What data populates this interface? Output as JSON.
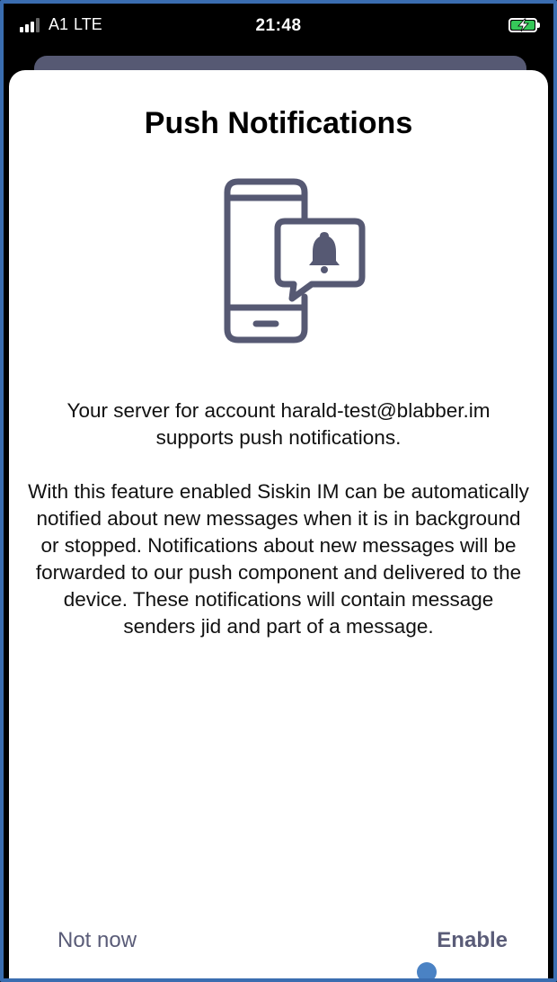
{
  "status_bar": {
    "carrier": "A1",
    "network": "LTE",
    "time": "21:48",
    "signal_bars_active": 3,
    "signal_bars_total": 4,
    "battery_icon": "battery-charging-icon",
    "battery_color": "#36c759"
  },
  "dialog": {
    "title": "Push Notifications",
    "illustration_icon": "phone-notification-bell-icon",
    "paragraph_1": "Your server for account harald-test@blabber.im supports push notifications.",
    "paragraph_2": "With this feature enabled Siskin IM can be automatically notified about new messages when it is in background or stopped. Notifications about new messages will be forwarded to our push component and delivered to the device. These notifications will contain message senders jid and part of a message.",
    "buttons": {
      "not_now": "Not now",
      "enable": "Enable"
    }
  },
  "colors": {
    "accent": "#565973",
    "frame_border": "#3a6db0",
    "touch_indicator": "#4a82c4"
  }
}
